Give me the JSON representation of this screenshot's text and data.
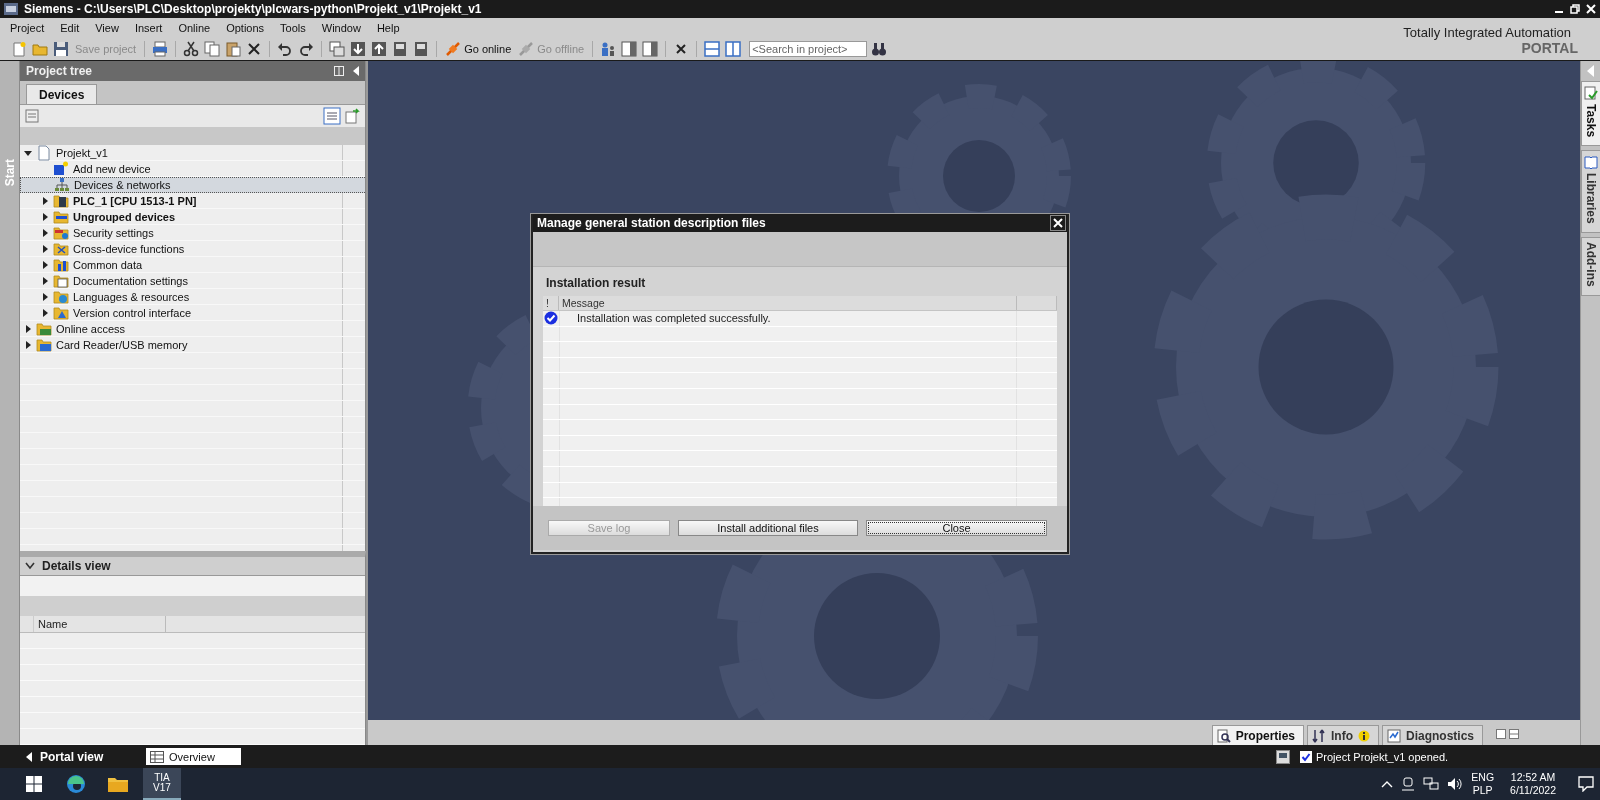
{
  "window": {
    "title": "Siemens  -  C:\\Users\\PLC\\Desktop\\projekty\\plcwars-python\\Projekt_v1\\Projekt_v1"
  },
  "menu": [
    "Project",
    "Edit",
    "View",
    "Insert",
    "Online",
    "Options",
    "Tools",
    "Window",
    "Help"
  ],
  "toolbar": {
    "buttons": [
      {
        "label": "Save project",
        "disabled": true
      },
      {
        "label": "Go online",
        "disabled": false
      },
      {
        "label": "Go offline",
        "disabled": true
      }
    ],
    "search": {
      "placeholder": "<Search in project>"
    }
  },
  "brand": {
    "line1": "Totally Integrated Automation",
    "line2": "PORTAL"
  },
  "start_strip": {
    "label": "Start"
  },
  "project_tree": {
    "title": "Project tree",
    "tabs": [
      {
        "label": "Devices",
        "selected": true
      }
    ],
    "items": [
      {
        "label": "Projekt_v1",
        "kind": "project",
        "expanded": true,
        "selected": false,
        "bold": false,
        "children": [
          {
            "label": "Add new device",
            "kind": "add-device",
            "selected": false,
            "bold": false
          },
          {
            "label": "Devices & networks",
            "kind": "network",
            "selected": true,
            "bold": false
          },
          {
            "label": "PLC_1 [CPU 1513-1 PN]",
            "kind": "plc",
            "expanded": false,
            "selected": false,
            "bold": true
          },
          {
            "label": "Ungrouped devices",
            "kind": "device-group",
            "expanded": false,
            "selected": false,
            "bold": true
          },
          {
            "label": "Security settings",
            "kind": "security",
            "expanded": false,
            "selected": false,
            "bold": false
          },
          {
            "label": "Cross-device functions",
            "kind": "cross-device",
            "expanded": false,
            "selected": false,
            "bold": false
          },
          {
            "label": "Common data",
            "kind": "common-data",
            "expanded": false,
            "selected": false,
            "bold": false
          },
          {
            "label": "Documentation settings",
            "kind": "documentation",
            "expanded": false,
            "selected": false,
            "bold": false
          },
          {
            "label": "Languages & resources",
            "kind": "languages",
            "expanded": false,
            "selected": false,
            "bold": false
          },
          {
            "label": "Version control interface",
            "kind": "version-control",
            "expanded": false,
            "selected": false,
            "bold": false
          }
        ]
      },
      {
        "label": "Online access",
        "kind": "online-access",
        "expanded": false,
        "selected": false,
        "bold": false
      },
      {
        "label": "Card Reader/USB memory",
        "kind": "card-reader",
        "expanded": false,
        "selected": false,
        "bold": false
      }
    ]
  },
  "details_view": {
    "title": "Details view",
    "expanded": true,
    "columns": [
      "Name"
    ]
  },
  "dialog": {
    "title": "Manage general station description files",
    "heading": "Installation result",
    "columns": [
      "!",
      "Message"
    ],
    "rows": [
      {
        "kind": "success",
        "message": "Installation was completed successfully."
      }
    ],
    "buttons": [
      {
        "label": "Save log",
        "disabled": true,
        "focused": false
      },
      {
        "label": "Install additional files",
        "disabled": false,
        "focused": false
      },
      {
        "label": "Close",
        "disabled": false,
        "focused": true
      }
    ]
  },
  "side_tabs": [
    {
      "label": "Tasks",
      "kind": "tasks",
      "selected": true
    },
    {
      "label": "Libraries",
      "kind": "libraries",
      "selected": false
    },
    {
      "label": "Add-ins",
      "kind": "addins",
      "selected": false
    }
  ],
  "inspector_tabs": [
    {
      "label": "Properties",
      "kind": "properties",
      "selected": true
    },
    {
      "label": "Info",
      "kind": "info",
      "selected": false
    },
    {
      "label": "Diagnostics",
      "kind": "diagnostics",
      "selected": false
    }
  ],
  "status_bar": {
    "portal_view": "Portal view",
    "tabs": [
      {
        "label": "Overview",
        "selected": true
      }
    ],
    "message": "Project Projekt_v1 opened."
  },
  "taskbar": {
    "app": {
      "line1": "TIA",
      "line2": "V17"
    },
    "language": "ENG",
    "layout": "PLP",
    "time": "12:52 AM",
    "date": "6/11/2022"
  }
}
